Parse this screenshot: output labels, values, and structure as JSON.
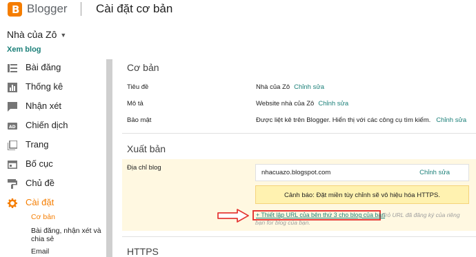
{
  "header": {
    "logo_letter": "B",
    "brand": "Blogger",
    "page_title": "Cài đặt cơ bản"
  },
  "blog": {
    "name": "Nhà của Zô",
    "view_blog": "Xem blog"
  },
  "sidebar": {
    "items": [
      {
        "label": "Bài đăng",
        "icon": "posts-icon"
      },
      {
        "label": "Thống kê",
        "icon": "stats-icon"
      },
      {
        "label": "Nhận xét",
        "icon": "comments-icon"
      },
      {
        "label": "Chiến dịch",
        "icon": "campaigns-icon"
      },
      {
        "label": "Trang",
        "icon": "pages-icon"
      },
      {
        "label": "Bố cục",
        "icon": "layout-icon"
      },
      {
        "label": "Chủ đề",
        "icon": "theme-icon"
      },
      {
        "label": "Cài đặt",
        "icon": "gear-icon"
      }
    ],
    "sub_items": [
      "Cơ bản",
      "Bài đăng, nhận xét và",
      "chia sẻ",
      "Email"
    ],
    "active_color": "#f57d00"
  },
  "basic": {
    "title": "Cơ bản",
    "rows": [
      {
        "label": "Tiêu đề",
        "value": "Nhà của Zô",
        "edit": "Chỉnh sửa"
      },
      {
        "label": "Mô tả",
        "value": "Website nhà của Zô",
        "edit": "Chỉnh sửa"
      },
      {
        "label": "Bảo mật",
        "value": "Được liệt kê trên Blogger. Hiển thị với các công cụ tìm kiếm.",
        "edit": "Chỉnh sửa"
      }
    ]
  },
  "publish": {
    "title": "Xuất bản",
    "address_label": "Địa chỉ blog",
    "url": "nhacuazo.blogspot.com",
    "edit": "Chỉnh sửa",
    "warning": "Cảnh báo: Đặt miền tùy chỉnh sẽ vô hiệu hóa HTTPS.",
    "setup_link": "+ Thiết lập URL của bên thứ 3 cho blog của bạn",
    "setup_desc_1": "Trỏ URL đã đăng ký của riêng",
    "setup_desc_2": "bạn for blog của bạn."
  },
  "https": {
    "title": "HTTPS"
  },
  "colors": {
    "accent": "#f57d00",
    "link": "#1a7f78",
    "highlight": "#e53935"
  }
}
